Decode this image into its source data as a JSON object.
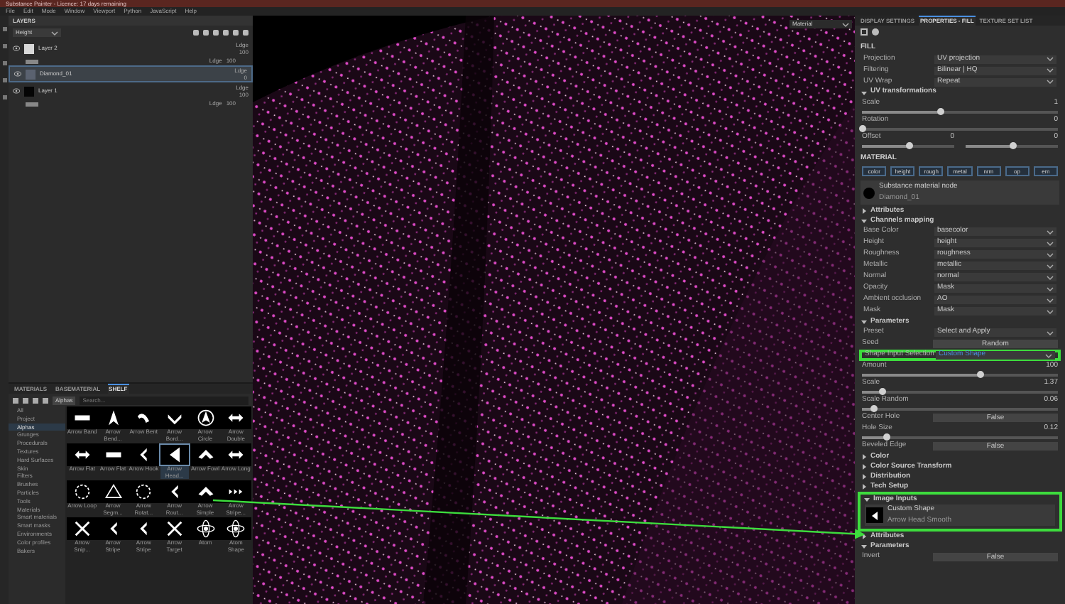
{
  "window": {
    "title": "Substance Painter - Licence: 17 days remaining"
  },
  "menu": [
    "File",
    "Edit",
    "Mode",
    "Window",
    "Viewport",
    "Python",
    "JavaScript",
    "Help"
  ],
  "layers": {
    "title": "LAYERS",
    "channel": "Height",
    "items": [
      {
        "name": "Layer 2",
        "selected": false,
        "blend": "Ldge",
        "opacity": "100",
        "color": "#d8d8d8",
        "effect": {
          "blend": "Ldge",
          "opacity": "100"
        }
      },
      {
        "name": "Diamond_01",
        "selected": true,
        "blend": "Ldge",
        "opacity": "0",
        "color": "#5a6270"
      },
      {
        "name": "Layer 1",
        "selected": false,
        "blend": "Ldge",
        "opacity": "100",
        "color": "#050505",
        "effect": {
          "blend": "Ldge",
          "opacity": "100"
        }
      }
    ]
  },
  "shelf": {
    "tabs": [
      {
        "label": "MATERIALS",
        "selected": false
      },
      {
        "label": "BASEMATERIAL",
        "selected": false
      },
      {
        "label": "SHELF",
        "selected": true
      }
    ],
    "filter": "Alphas",
    "placeholder": "Search...",
    "categories": [
      {
        "label": "All",
        "selected": false
      },
      {
        "label": "Project",
        "selected": false
      },
      {
        "label": "Alphas",
        "selected": true
      },
      {
        "label": "Grunges",
        "selected": false
      },
      {
        "label": "Procedurals",
        "selected": false
      },
      {
        "label": "Textures",
        "selected": false
      },
      {
        "label": "Hard Surfaces",
        "selected": false
      },
      {
        "label": "Skin",
        "selected": false
      },
      {
        "label": "Filters",
        "selected": false
      },
      {
        "label": "Brushes",
        "selected": false
      },
      {
        "label": "Particles",
        "selected": false
      },
      {
        "label": "Tools",
        "selected": false
      },
      {
        "label": "Materials",
        "selected": false
      },
      {
        "label": "Smart materials",
        "selected": false
      },
      {
        "label": "Smart masks",
        "selected": false
      },
      {
        "label": "Environments",
        "selected": false
      },
      {
        "label": "Color profiles",
        "selected": false
      },
      {
        "label": "Bakers",
        "selected": false
      }
    ],
    "thumbnails": [
      {
        "kind": "bar",
        "label": "Arrow Band",
        "selected": false
      },
      {
        "kind": "spike",
        "label": "Arrow Bend...",
        "selected": false
      },
      {
        "kind": "curve",
        "label": "Arrow Bent",
        "selected": false
      },
      {
        "kind": "chevron",
        "label": "Arrow Bord...",
        "selected": false
      },
      {
        "kind": "circle",
        "label": "Arrow Circle",
        "selected": false
      },
      {
        "kind": "double",
        "label": "Arrow Double",
        "selected": false
      },
      {
        "kind": "double",
        "label": "Arrow Flat",
        "selected": false
      },
      {
        "kind": "bar",
        "label": "Arrow Flat",
        "selected": false
      },
      {
        "kind": "left",
        "label": "Arrow Hook",
        "selected": false
      },
      {
        "kind": "head",
        "label": "Arrow Head...",
        "selected": true
      },
      {
        "kind": "up",
        "label": "Arrow Fowl",
        "selected": false
      },
      {
        "kind": "double",
        "label": "Arrow Long",
        "selected": false
      },
      {
        "kind": "ring",
        "label": "Arrow Loop",
        "selected": false
      },
      {
        "kind": "triangle",
        "label": "Arrow Segm...",
        "selected": false
      },
      {
        "kind": "ring",
        "label": "Arrow Rotat...",
        "selected": false
      },
      {
        "kind": "left",
        "label": "Arrow Rout...",
        "selected": false
      },
      {
        "kind": "up",
        "label": "Arrow Simple",
        "selected": false
      },
      {
        "kind": "dots",
        "label": "Arrow Stripe...",
        "selected": false
      },
      {
        "kind": "cross",
        "label": "Arrow Snip...",
        "selected": false
      },
      {
        "kind": "left",
        "label": "Arrow Stripe",
        "selected": false
      },
      {
        "kind": "left",
        "label": "Arrow Stripe",
        "selected": false
      },
      {
        "kind": "cross",
        "label": "Arrow Target",
        "selected": false
      },
      {
        "kind": "atom",
        "label": "Atom",
        "selected": false
      },
      {
        "kind": "atom",
        "label": "Atom Shape",
        "selected": false
      }
    ]
  },
  "viewport": {
    "mode": "Material"
  },
  "properties": {
    "tabs": [
      {
        "label": "DISPLAY SETTINGS",
        "selected": false
      },
      {
        "label": "PROPERTIES - FILL",
        "selected": true
      },
      {
        "label": "TEXTURE SET LIST",
        "selected": false
      }
    ],
    "items": [
      {
        "kind": "header",
        "title": "FILL"
      },
      {
        "kind": "select",
        "label": "Projection",
        "value": "UV projection",
        "highlighted": false
      },
      {
        "kind": "select",
        "label": "Filtering",
        "value": "Bilinear | HQ",
        "highlighted": false
      },
      {
        "kind": "select",
        "label": "UV Wrap",
        "value": "Repeat",
        "highlighted": false
      },
      {
        "kind": "section",
        "title": "UV transformations",
        "expanded": true
      },
      {
        "kind": "slider",
        "label": "Scale",
        "value": "1",
        "level": 0.4
      },
      {
        "kind": "slider",
        "label": "Rotation",
        "value": "0",
        "level": 0.0
      },
      {
        "kind": "dual",
        "label": "Offset",
        "sliders": [
          {
            "value": "0",
            "level": 0.5
          },
          {
            "value": "0",
            "level": 0.5
          }
        ]
      },
      {
        "kind": "header",
        "title": "MATERIAL"
      },
      {
        "kind": "chips",
        "chips": [
          {
            "label": "color"
          },
          {
            "label": "height"
          },
          {
            "label": "rough"
          },
          {
            "label": "metal"
          },
          {
            "label": "nrm"
          },
          {
            "label": "op"
          },
          {
            "label": "em"
          }
        ]
      },
      {
        "kind": "node",
        "title": "Substance material node",
        "subtitle": "Diamond_01"
      },
      {
        "kind": "section",
        "title": "Attributes",
        "expanded": false
      },
      {
        "kind": "section",
        "title": "Channels mapping",
        "expanded": true
      },
      {
        "kind": "select",
        "label": "Base Color",
        "value": "basecolor",
        "highlighted": false
      },
      {
        "kind": "select",
        "label": "Height",
        "value": "height",
        "highlighted": false
      },
      {
        "kind": "select",
        "label": "Roughness",
        "value": "roughness",
        "highlighted": false
      },
      {
        "kind": "select",
        "label": "Metallic",
        "value": "metallic",
        "highlighted": false
      },
      {
        "kind": "select",
        "label": "Normal",
        "value": "normal",
        "highlighted": false
      },
      {
        "kind": "select",
        "label": "Opacity",
        "value": "Mask",
        "highlighted": false
      },
      {
        "kind": "select",
        "label": "Ambient occlusion",
        "value": "AO",
        "highlighted": false
      },
      {
        "kind": "select",
        "label": "Mask",
        "value": "Mask",
        "highlighted": false
      },
      {
        "kind": "section",
        "title": "Parameters",
        "expanded": true
      },
      {
        "kind": "select",
        "label": "Preset",
        "value": "Select and Apply",
        "highlighted": false
      },
      {
        "kind": "button",
        "label": "Seed",
        "value": "Random"
      },
      {
        "kind": "select",
        "label": "Shape Input Selection",
        "value": "Custom Shape",
        "highlighted": true
      },
      {
        "kind": "slider",
        "label": "Amount",
        "value": "100",
        "level": 0.6
      },
      {
        "kind": "slider",
        "label": "Scale",
        "value": "1.37",
        "level": 0.1
      },
      {
        "kind": "slider",
        "label": "Scale Random",
        "value": "0.06",
        "level": 0.06
      },
      {
        "kind": "button",
        "label": "Center Hole",
        "value": "False"
      },
      {
        "kind": "slider",
        "label": "Hole Size",
        "value": "0.12",
        "level": 0.12
      },
      {
        "kind": "button",
        "label": "Beveled Edge",
        "value": "False"
      },
      {
        "kind": "section",
        "title": "Color",
        "expanded": false
      },
      {
        "kind": "section",
        "title": "Color Source Transform",
        "expanded": false
      },
      {
        "kind": "section",
        "title": "Distribution",
        "expanded": false
      },
      {
        "kind": "section",
        "title": "Tech Setup",
        "expanded": false
      },
      {
        "kind": "section",
        "title": "Image Inputs",
        "expanded": true,
        "highlighted": true,
        "node": {
          "title": "Custom Shape",
          "subtitle": "Arrow Head Smooth"
        }
      },
      {
        "kind": "section",
        "title": "Attributes",
        "expanded": false
      },
      {
        "kind": "section",
        "title": "Parameters",
        "expanded": true
      },
      {
        "kind": "button",
        "label": "Invert",
        "value": "False"
      }
    ]
  }
}
